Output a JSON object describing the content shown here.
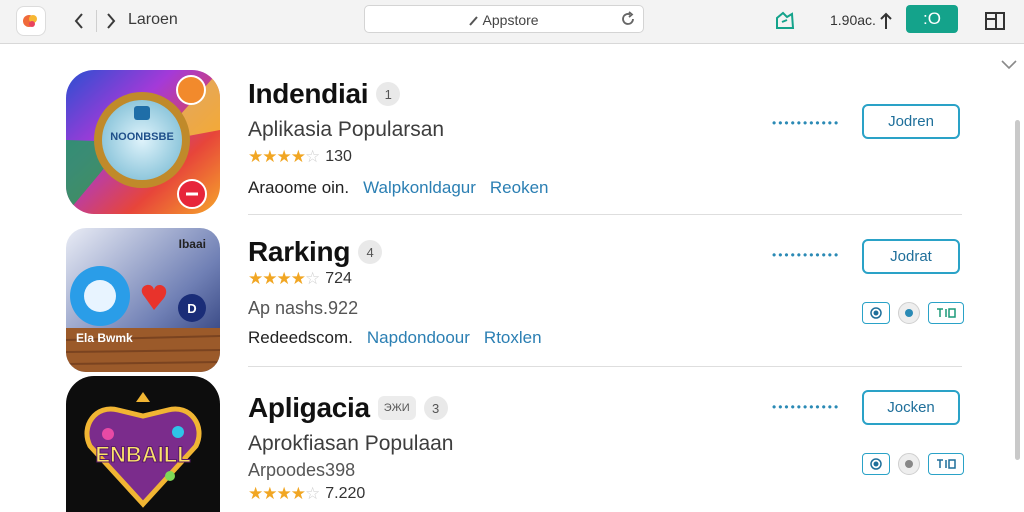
{
  "toolbar": {
    "nav_label": "Laroen",
    "address": "Appstore",
    "right_text": "1.90ac.",
    "badge": ":O"
  },
  "icons": [
    "app-logo-icon",
    "back-icon",
    "forward-icon",
    "lock-icon",
    "reload-icon",
    "share-icon",
    "upload-icon",
    "sidebar-icon",
    "chevron-down-icon"
  ],
  "apps": [
    {
      "name": "Indendiai",
      "pill": "1",
      "subtitle": "Aplikasia Popularsan",
      "rating_value": 4.5,
      "rating_count": "130",
      "links": [
        "Araoome oin.",
        "Walpkonldagur",
        "Reoken"
      ],
      "icon_text": "NOONBSBE",
      "dots": "•••••••••••",
      "action_label": "Jodren"
    },
    {
      "name": "Rarking",
      "pill": "4",
      "rating_value": 4.5,
      "rating_count": "724",
      "subtitle": "Ap nashs.922",
      "links": [
        "Redeedscom.",
        "Napdondoour",
        "Rtoxlen"
      ],
      "icon_text_top": "Ibaai",
      "icon_text_bottom": "Ela Bwmk",
      "dots": "•••••••••••",
      "action_label": "Jodrat"
    },
    {
      "name": "Apligacia",
      "pill_sq": "ЭЖИ",
      "pill": "3",
      "subtitle": "Aprokfiasan Populaan",
      "subtitle2": "Arpoodes398",
      "rating_value": 4,
      "rating_count": "7.220",
      "icon_text": "ENBAILL",
      "dots": "•••••••••••",
      "action_label": "Jocken"
    }
  ],
  "colors": {
    "accent": "#14a38b",
    "link": "#2b7fb3",
    "button_border": "#2aa2c7",
    "star": "#f1a623"
  }
}
